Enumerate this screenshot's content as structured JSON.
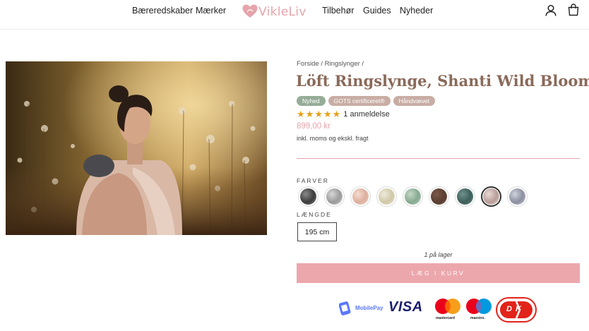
{
  "header": {
    "nav_left": [
      "Bæreredskaber",
      "Mærker"
    ],
    "logo_text": "VikleLiv",
    "nav_right": [
      "Tilbehør",
      "Guides",
      "Nyheder"
    ]
  },
  "breadcrumb": [
    "Forside",
    "Ringslynger"
  ],
  "product": {
    "title": "Löft Ringslynge, Shanti Wild Bloom",
    "badges": [
      {
        "label": "Nyhed",
        "color": "#95ac98"
      },
      {
        "label": "GOTS certificeret®",
        "color": "#c8ada4"
      },
      {
        "label": "Håndvævet",
        "color": "#c8ada4"
      }
    ],
    "rating": 5,
    "reviews_text": "1 anmeldelse",
    "price": "899,00 kr",
    "tax_note": "inkl. moms og ekskl. fragt"
  },
  "colors_label": "FARVER",
  "swatch_colors": [
    {
      "color": "#3b3b3b",
      "accent": "#8a8a8a"
    },
    {
      "color": "#9a9a9a",
      "accent": "#d6d6d6"
    },
    {
      "color": "#dcae9c",
      "accent": "#f3dcd2"
    },
    {
      "color": "#cfc8a6",
      "accent": "#eeeadb"
    },
    {
      "color": "#84a88e",
      "accent": "#c5d8c9"
    },
    {
      "color": "#5a3e31",
      "accent": "#7a5848"
    },
    {
      "color": "#3d5e5a",
      "accent": "#6f918c"
    },
    {
      "color": "#b79d98",
      "accent": "#e8d9d5"
    },
    {
      "color": "#8a8e9e",
      "accent": "#d1d3dd"
    }
  ],
  "selected_swatch": 7,
  "length_label": "LÆNGDE",
  "length_value": "195 cm",
  "stock_text": "1 på lager",
  "add_to_cart_label": "LÆG I KURV",
  "payment": {
    "mobilepay": "MobilePay",
    "visa": "VISA",
    "mastercard": "mastercard",
    "maestro": "maestro.",
    "dankort": "DK"
  },
  "colors": {
    "brand_pink": "#e6a4ab",
    "title_brown": "#8a6a5a",
    "star_gold": "#e5a11b"
  }
}
